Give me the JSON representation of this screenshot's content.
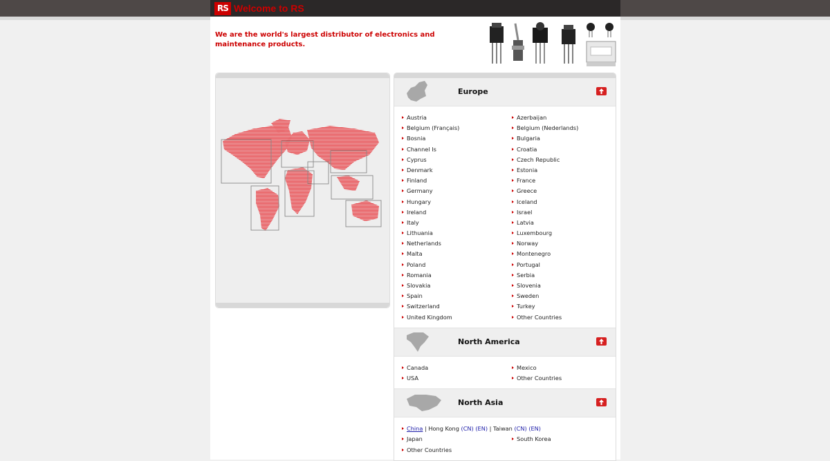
{
  "header": {
    "logo_text": "RS",
    "welcome": "Welcome to RS",
    "tagline": "We are the world's largest distributor of electronics and maintenance products."
  },
  "colors": {
    "brand_red": "#cc0000",
    "header_dark": "#2b2828"
  },
  "regions": {
    "europe": {
      "title": "Europe",
      "countries": [
        "Austria",
        "Azerbaijan",
        "Belgium (Français)",
        "Belgium (Nederlands)",
        "Bosnia",
        "Bulgaria",
        "Channel Is",
        "Croatia",
        "Cyprus",
        "Czech Republic",
        "Denmark",
        "Estonia",
        "Finland",
        "France",
        "Germany",
        "Greece",
        "Hungary",
        "Iceland",
        "Ireland",
        "Israel",
        "Italy",
        "Latvia",
        "Lithuania",
        "Luxembourg",
        "Netherlands",
        "Norway",
        "Malta",
        "Montenegro",
        "Poland",
        "Portugal",
        "Romania",
        "Serbia",
        "Slovakia",
        "Slovenia",
        "Spain",
        "Sweden",
        "Switzerland",
        "Turkey",
        "United Kingdom",
        "Other Countries"
      ]
    },
    "north_america": {
      "title": "North America",
      "countries": [
        "Canada",
        "Mexico",
        "USA",
        "Other Countries"
      ]
    },
    "north_asia": {
      "title": "North Asia",
      "china": "China",
      "sep": "|",
      "hong_kong": "Hong Kong",
      "taiwan": "Taiwan",
      "cn": "(CN)",
      "en": "(EN)",
      "japan": "Japan",
      "south_korea": "South Korea",
      "other": "Other Countries"
    }
  }
}
